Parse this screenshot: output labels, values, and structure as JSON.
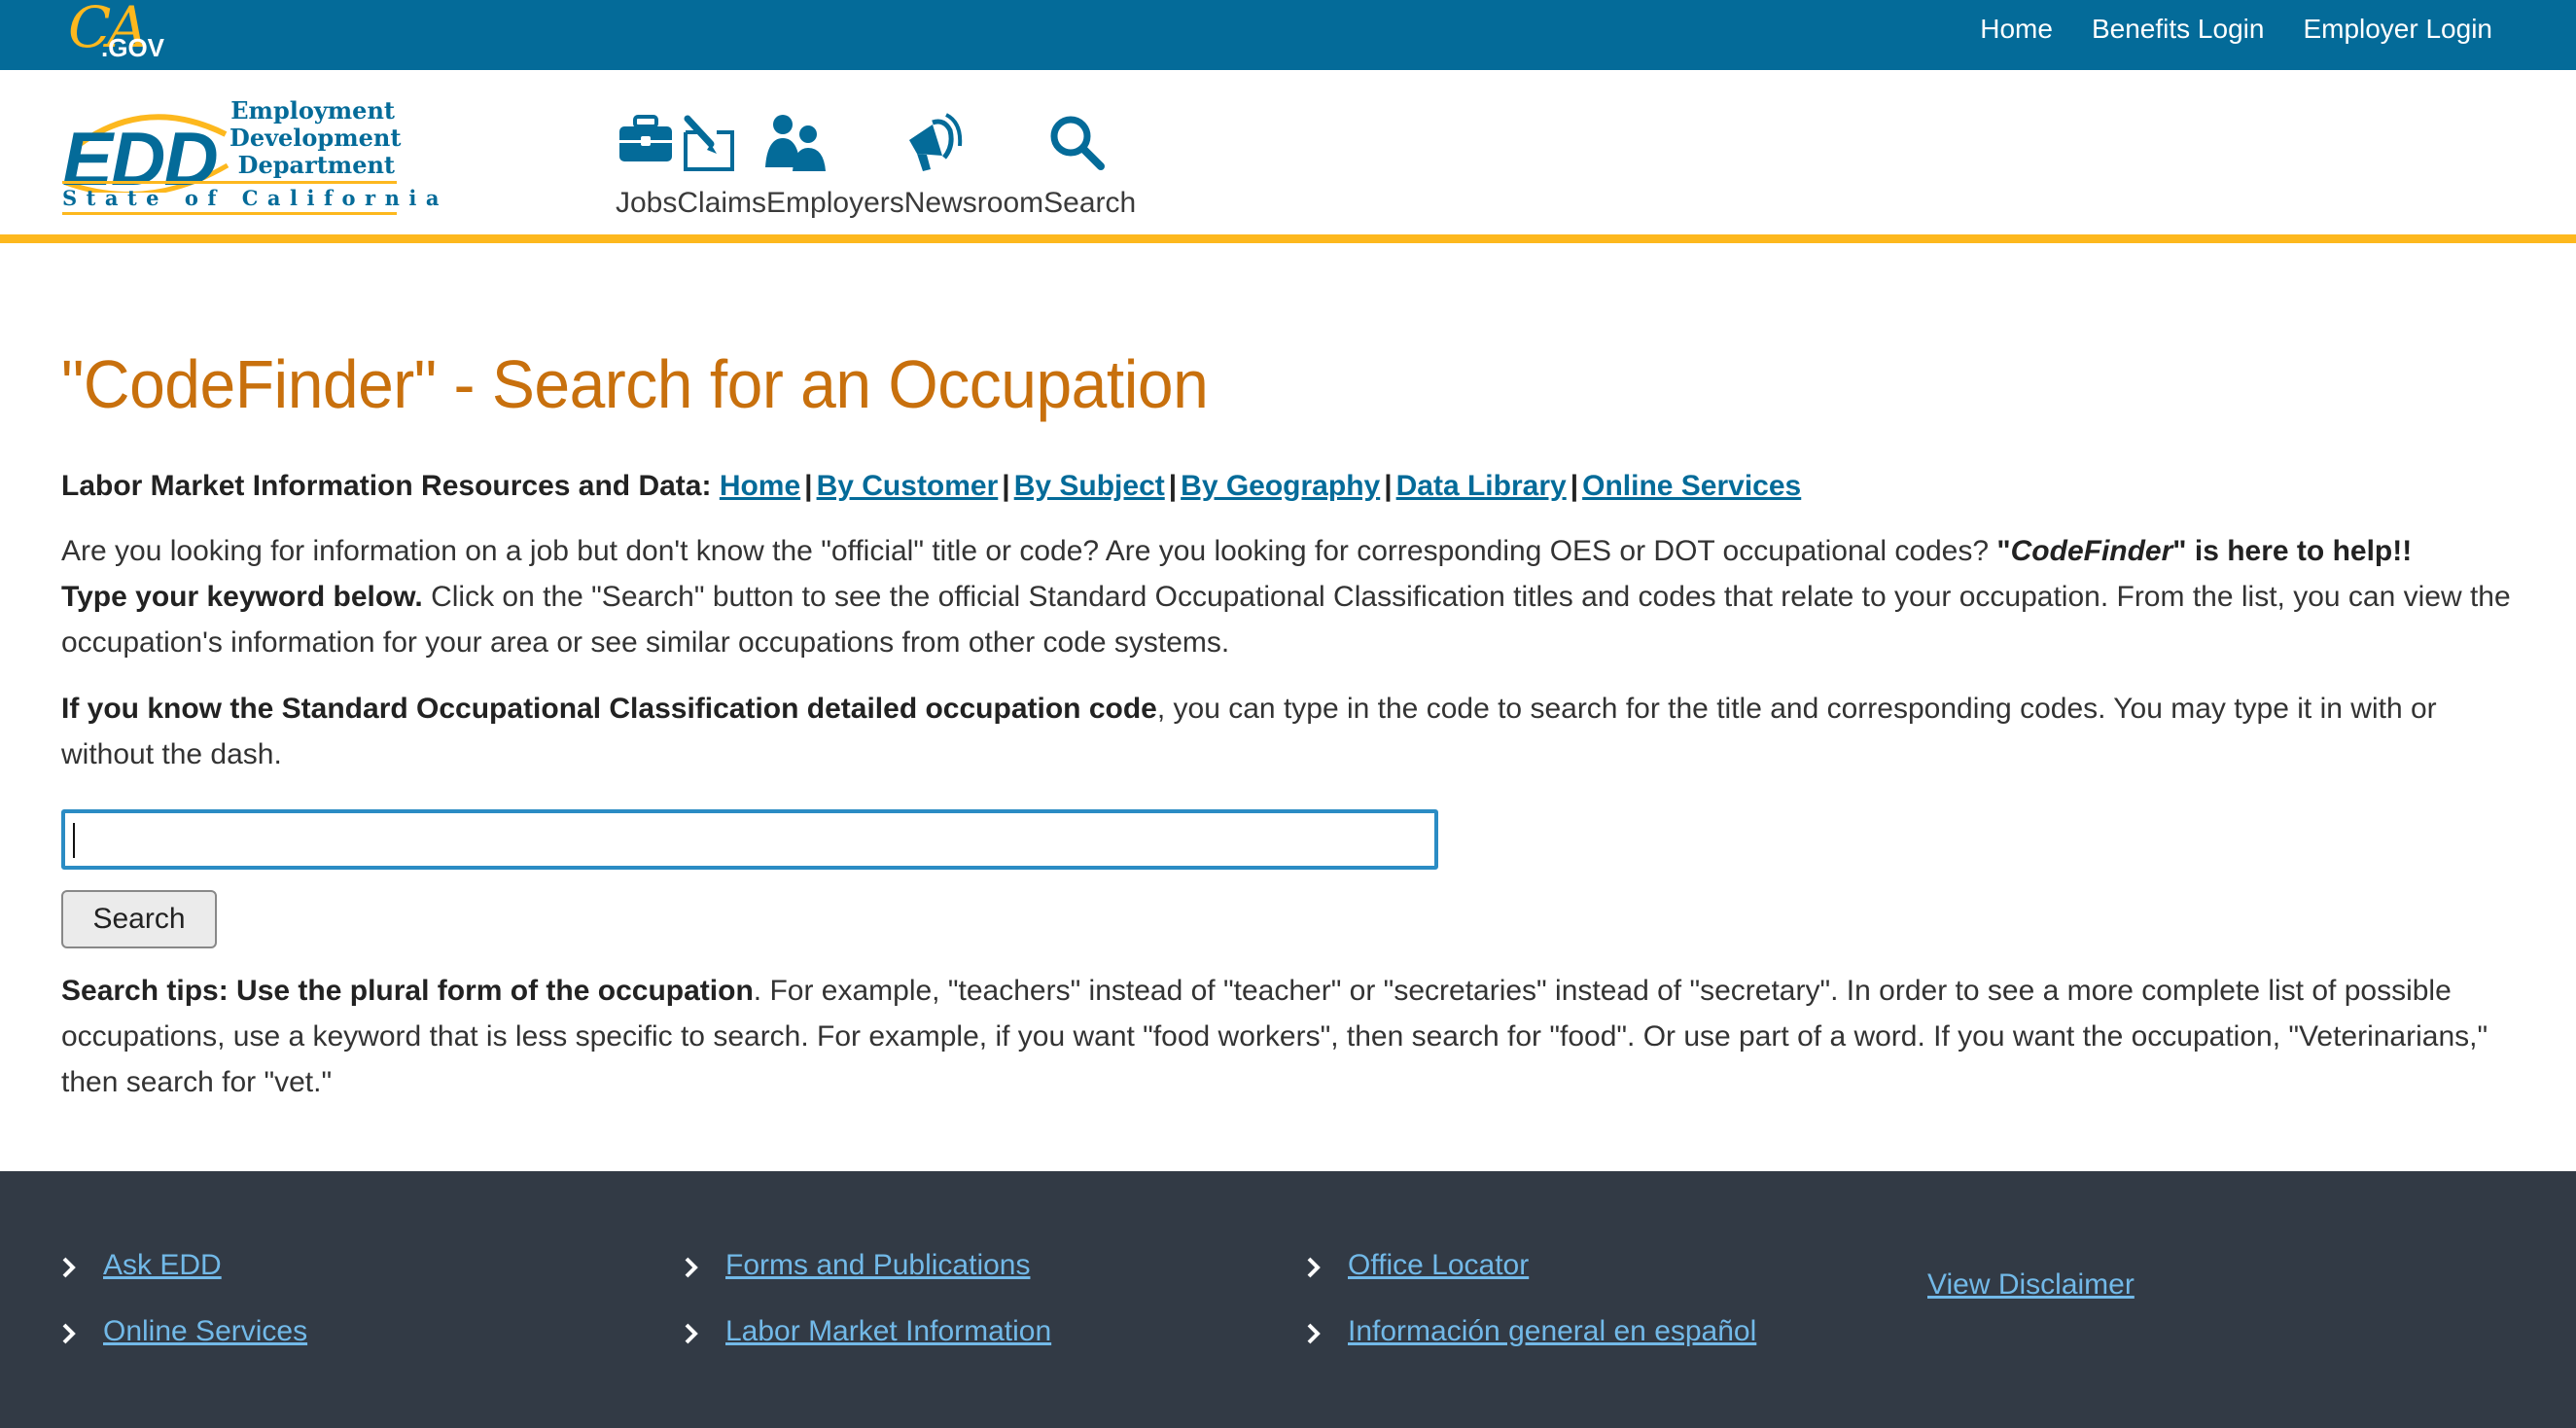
{
  "topbar": {
    "logo_ca": "CA",
    "logo_gov": ".GOV",
    "links": [
      "Home",
      "Benefits Login",
      "Employer Login"
    ]
  },
  "header": {
    "logo_letters": "EDD",
    "logo_words": [
      "Employment",
      "Development",
      "Department"
    ],
    "logo_state": "State of California",
    "nav": [
      {
        "label": "Jobs",
        "icon": "briefcase-icon"
      },
      {
        "label": "Claims",
        "icon": "claim-form-icon"
      },
      {
        "label": "Employers",
        "icon": "people-icon"
      },
      {
        "label": "Newsroom",
        "icon": "megaphone-icon"
      },
      {
        "label": "Search",
        "icon": "search-icon"
      }
    ]
  },
  "main": {
    "title": "\"CodeFinder\" - Search for an Occupation",
    "lmi_label": "Labor Market Information Resources and Data:",
    "lmi_links": [
      "Home",
      "By Customer",
      "By Subject",
      "By Geography",
      "Data Library",
      "Online Services"
    ],
    "intro_1a": "Are you looking for information on a job but don't know the \"official\" title or code?   Are you looking for corresponding OES or DOT occupational codes? ",
    "intro_1b": " \"",
    "intro_1c": "CodeFinder",
    "intro_1d": "\" is here to help!!",
    "intro_2b": "Type your keyword below.",
    "intro_2": "  Click on the \"Search\" button to see the official Standard Occupational Classification titles and codes that relate to your occupation.  From the list, you can view the occupation's information for your area or see similar occupations from other code systems.",
    "soc_bold": "If you know the Standard Occupational Classification detailed occupation code",
    "soc_rest": ", you can type in the code to search for the title and corresponding codes. You may type it in with or without the dash.",
    "search_value": "",
    "search_button": "Search",
    "tips_bold": "Search tips: Use the plural form of the occupation",
    "tips_rest": ". For example, \"teachers\" instead of \"teacher\" or \"secretaries\" instead of \"secretary\". In order to see a more complete list of possible occupations, use a keyword that is less specific to search.  For example, if you want \"food workers\", then search for \"food\".  Or use part of a word.  If you want the occupation, \"Veterinarians,\" then search for \"vet.\""
  },
  "footer": {
    "col1": [
      "Ask EDD",
      "Online Services"
    ],
    "col2": [
      "Forms and Publications",
      "Labor Market Information"
    ],
    "col3": [
      "Office Locator",
      "Información general en español"
    ],
    "disclaimer": "View Disclaimer"
  },
  "colors": {
    "topbar": "#046b99",
    "accent_gold": "#fdb81e",
    "title_orange": "#c8700d",
    "link_blue": "#046b99",
    "footer_bg": "#323a45",
    "footer_link": "#72b9e8"
  }
}
